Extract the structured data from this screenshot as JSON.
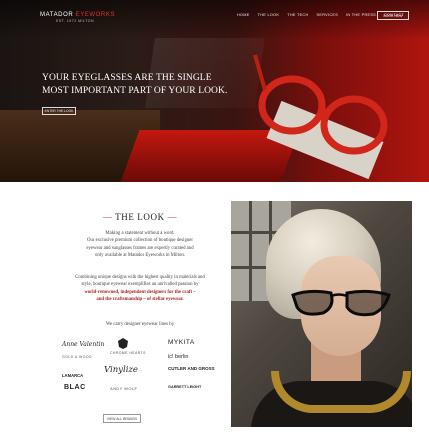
{
  "header": {
    "logo_main_1": "MATADOR",
    "logo_main_2": "EYEWORKS",
    "logo_sub": "EST. 1972 MILTON",
    "nav": [
      "HOME",
      "THE LOOK",
      "THE TECH",
      "SERVICES",
      "IN THE PRESS",
      "CONTACT"
    ],
    "book_button": "BOOK NOW"
  },
  "hero": {
    "title_line1": "YOUR EYEGLASSES ARE THE SINGLE",
    "title_line2": "MOST IMPORTANT PART OF YOUR LOOK.",
    "button": "ENTER THE LOOK"
  },
  "look": {
    "heading": "THE LOOK",
    "para1_line1": "Making a statement without a word.",
    "para1_line2": "Our exclusive premium collection of boutique designer",
    "para1_line3": "eyewear and sunglasses frames are expertly curated and",
    "para1_line4": "only available at Matador Eyeworks in Milton.",
    "para2_line1": "Combining unique designs with the highest quality in materials and",
    "para2_line2": "style, boutique eyewear exemplifies an unrivalled passion by",
    "para2_red_line1": "world-renowned, independent designers for the craft –",
    "para2_red_line2": "and the craftsmanship – of stellar eyewear.",
    "carry": "We carry designer eyewear lines by"
  },
  "brands": {
    "anne_valentin": "Anne Valentin",
    "chrome_hearts": "CHROME HEARTS",
    "mykita": "MYKITA",
    "gold_wood": "GOLD & WOOD",
    "ic_berlin": "ic! berlin",
    "cutler_gross": "CUTLER AND GROSS",
    "lamarca": "LAMARCA",
    "vinylize": "Vinylize",
    "blac": "BLAC",
    "andy_wolf": "ANDY WOLF",
    "garrett_leight": "GARRETT LEIGHT"
  },
  "view_all_button": "VIEW ALL BRANDS",
  "colors": {
    "accent_red": "#c0302b",
    "dark": "#222222"
  }
}
